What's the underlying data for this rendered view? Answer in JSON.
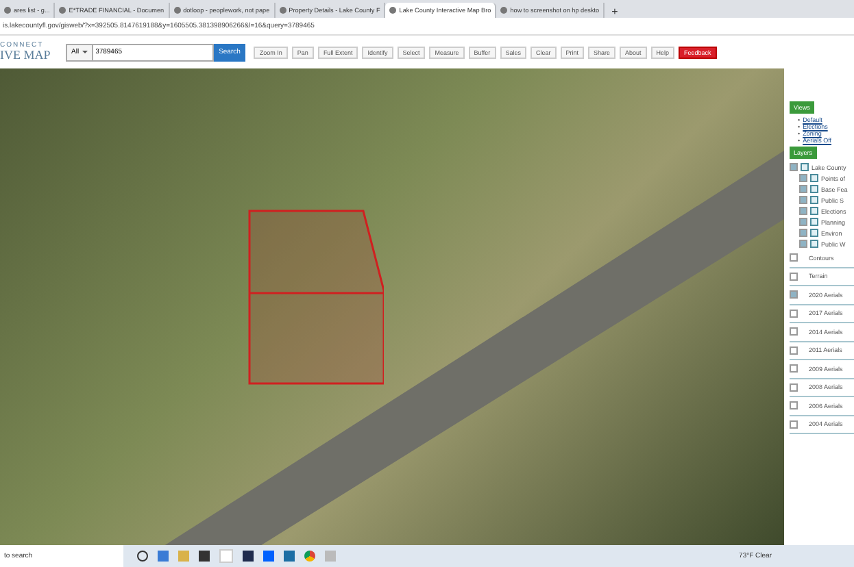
{
  "browser": {
    "tabs": [
      {
        "title": "ares list - g...",
        "selected": false
      },
      {
        "title": "E*TRADE FINANCIAL - Documen",
        "selected": false
      },
      {
        "title": "dotloop - peoplework, not pape",
        "selected": false
      },
      {
        "title": "Property Details - Lake County F",
        "selected": false
      },
      {
        "title": "Lake County Interactive Map Bro",
        "selected": true
      },
      {
        "title": "how to screenshot on hp deskto",
        "selected": false
      }
    ],
    "new_tab": "+",
    "url": "is.lakecountyfl.gov/gisweb/?x=392505.8147619188&y=1605505.381398906266&l=16&query=3789465"
  },
  "app": {
    "logo_top": "CONNECT",
    "logo_bottom": "IVE MAP",
    "scope": "All",
    "search_value": "3789465",
    "search_button": "Search",
    "tools": [
      {
        "label": "Zoom In",
        "kind": "normal"
      },
      {
        "label": "Pan",
        "kind": "normal"
      },
      {
        "label": "Full Extent",
        "kind": "normal"
      },
      {
        "label": "Identify",
        "kind": "normal"
      },
      {
        "label": "Select",
        "kind": "normal"
      },
      {
        "label": "Measure",
        "kind": "normal"
      },
      {
        "label": "Buffer",
        "kind": "normal"
      },
      {
        "label": "Sales",
        "kind": "normal"
      },
      {
        "label": "Clear",
        "kind": "normal"
      },
      {
        "label": "Print",
        "kind": "normal"
      },
      {
        "label": "Share",
        "kind": "normal"
      },
      {
        "label": "About",
        "kind": "normal"
      },
      {
        "label": "Help",
        "kind": "normal"
      },
      {
        "label": "Feedback",
        "kind": "alert"
      }
    ]
  },
  "panel": {
    "views_heading": "Views",
    "bullet": "•",
    "views": [
      "Default",
      "Elections",
      "Zoning",
      "Aerials Off"
    ],
    "layers_heading": "Layers",
    "group": {
      "label": "Lake County",
      "checked": true,
      "children": [
        {
          "label": "Points of",
          "checked": true
        },
        {
          "label": "Base Fea",
          "checked": true
        },
        {
          "label": "Public S",
          "checked": true
        },
        {
          "label": "Elections",
          "checked": true
        },
        {
          "label": "Planning",
          "checked": true
        },
        {
          "label": "Environ",
          "checked": true
        },
        {
          "label": "Public W",
          "checked": true
        }
      ]
    },
    "layers": [
      {
        "label": "Contours",
        "checked": false
      },
      {
        "label": "Terrain",
        "checked": false
      },
      {
        "label": "2020 Aerials",
        "checked": true
      },
      {
        "label": "2017 Aerials",
        "checked": false
      },
      {
        "label": "2014 Aerials",
        "checked": false
      },
      {
        "label": "2011 Aerials",
        "checked": false
      },
      {
        "label": "2009 Aerials",
        "checked": false
      },
      {
        "label": "2008 Aerials",
        "checked": false
      },
      {
        "label": "2006 Aerials",
        "checked": false
      },
      {
        "label": "2004 Aerials",
        "checked": false
      }
    ]
  },
  "taskbar": {
    "search": "to search",
    "weather": "73°F Clear"
  }
}
